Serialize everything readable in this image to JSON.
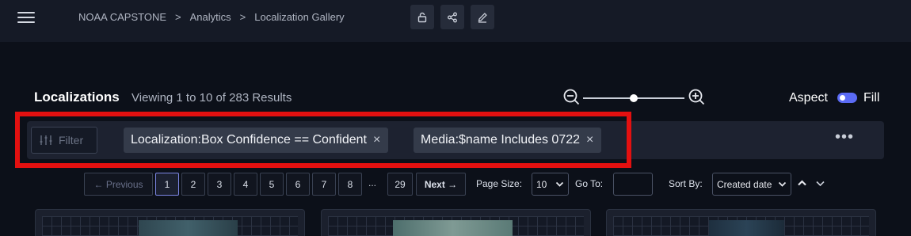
{
  "header": {
    "breadcrumb": [
      "NOAA CAPSTONE",
      "Analytics",
      "Localization Gallery"
    ],
    "separator": ">",
    "buttons": [
      "lock-icon",
      "share-icon",
      "edit-icon"
    ]
  },
  "page": {
    "title": "Localizations",
    "subtitle": "Viewing 1 to 10 of 283 Results"
  },
  "view_controls": {
    "zoom_level": 0.5,
    "aspect_label": "Aspect",
    "fill_label": "Fill",
    "fill_enabled": true
  },
  "filter": {
    "placeholder": "Filter",
    "chips": [
      {
        "text": "Localization:Box Confidence == Confident",
        "remove": "×"
      },
      {
        "text": "Media:$name Includes 0722",
        "remove": "×"
      }
    ],
    "more": "•••"
  },
  "pagination": {
    "previous": "← Previous",
    "pages": [
      "1",
      "2",
      "3",
      "4",
      "5",
      "6",
      "7",
      "8"
    ],
    "current_page": "1",
    "ellipsis": "...",
    "last_page": "29",
    "next": "Next →",
    "page_size_label": "Page Size:",
    "page_size": "10",
    "goto_label": "Go To:",
    "goto_value": "",
    "sort_label": "Sort By:",
    "sort_value": "Created date"
  },
  "colors": {
    "background": "#0c1019",
    "topbar": "#151a26",
    "accent": "#5b6bf5",
    "highlight": "#e31010"
  }
}
